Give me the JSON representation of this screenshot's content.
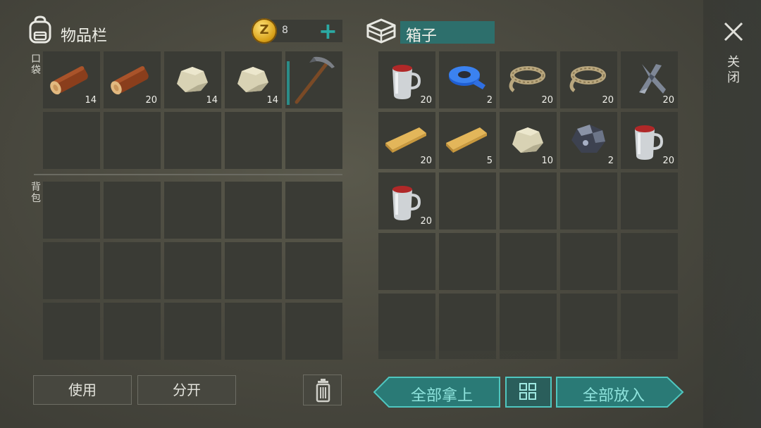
{
  "inventory": {
    "title": "物品栏",
    "coins": "8",
    "add_label": "+",
    "pocket_label": "口袋",
    "backpack_label": "背包",
    "pocket_slots": [
      {
        "item": "wood-log",
        "qty": "14"
      },
      {
        "item": "wood-log",
        "qty": "20"
      },
      {
        "item": "stone",
        "qty": "14"
      },
      {
        "item": "stone",
        "qty": "14"
      },
      {
        "item": "pickaxe",
        "qty": ""
      }
    ],
    "use_label": "使用",
    "split_label": "分开"
  },
  "chest": {
    "title": "箱子",
    "slots": [
      {
        "item": "red-mug",
        "qty": "20"
      },
      {
        "item": "blue-tape",
        "qty": "2"
      },
      {
        "item": "rope",
        "qty": "20"
      },
      {
        "item": "rope",
        "qty": "20"
      },
      {
        "item": "metal-scrap",
        "qty": "20"
      },
      {
        "item": "wood-plank",
        "qty": "20"
      },
      {
        "item": "wood-plank",
        "qty": "5"
      },
      {
        "item": "stone",
        "qty": "10"
      },
      {
        "item": "iron-ore",
        "qty": "2"
      },
      {
        "item": "red-mug",
        "qty": "20"
      },
      {
        "item": "red-mug",
        "qty": "20"
      }
    ],
    "take_all_label": "全部拿上",
    "put_all_label": "全部放入"
  },
  "close_label": "关闭",
  "colors": {
    "accent": "#2ba9a3",
    "slot": "#3a3b35",
    "title_bg": "#2d6f6c"
  }
}
